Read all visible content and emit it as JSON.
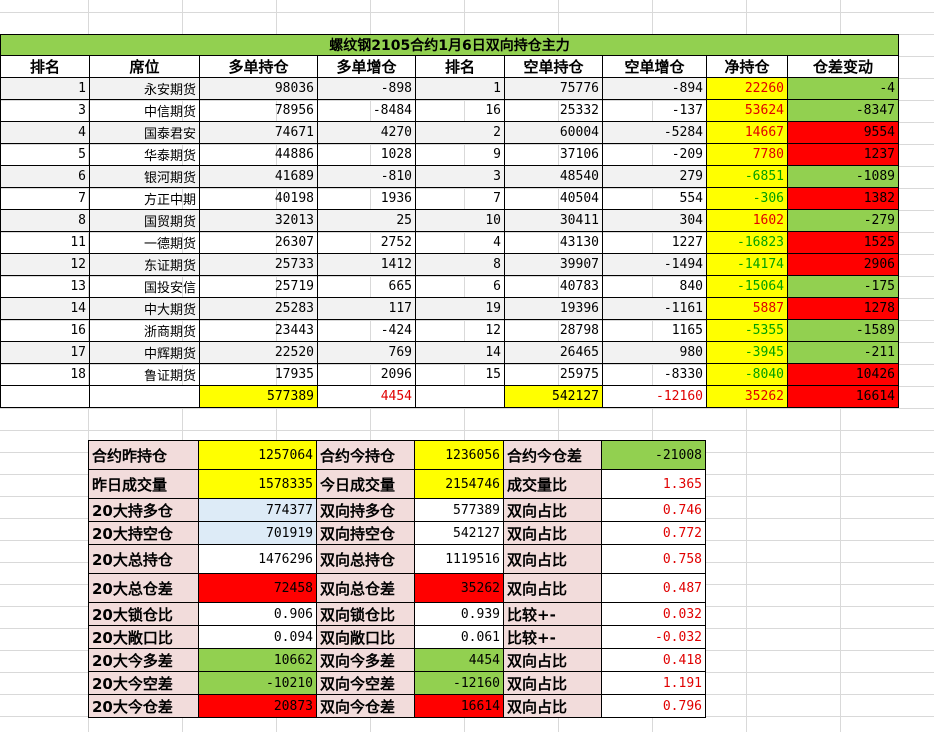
{
  "title": "螺纹钢2105合约1月6日双向持仓主力",
  "headers": [
    "排名",
    "席位",
    "多单持仓",
    "多单增仓",
    "排名",
    "空单持仓",
    "空单增仓",
    "净持仓",
    "仓差变动"
  ],
  "rows": [
    {
      "rank": "1",
      "name": "永安期货",
      "long": "98036",
      "long_chg": "-898",
      "srank": "1",
      "short": "75776",
      "short_chg": "-894",
      "net": "22260",
      "diff": "-4"
    },
    {
      "rank": "3",
      "name": "中信期货",
      "long": "78956",
      "long_chg": "-8484",
      "srank": "16",
      "short": "25332",
      "short_chg": "-137",
      "net": "53624",
      "diff": "-8347"
    },
    {
      "rank": "4",
      "name": "国泰君安",
      "long": "74671",
      "long_chg": "4270",
      "srank": "2",
      "short": "60004",
      "short_chg": "-5284",
      "net": "14667",
      "diff": "9554"
    },
    {
      "rank": "5",
      "name": "华泰期货",
      "long": "44886",
      "long_chg": "1028",
      "srank": "9",
      "short": "37106",
      "short_chg": "-209",
      "net": "7780",
      "diff": "1237"
    },
    {
      "rank": "6",
      "name": "银河期货",
      "long": "41689",
      "long_chg": "-810",
      "srank": "3",
      "short": "48540",
      "short_chg": "279",
      "net": "-6851",
      "diff": "-1089"
    },
    {
      "rank": "7",
      "name": "方正中期",
      "long": "40198",
      "long_chg": "1936",
      "srank": "7",
      "short": "40504",
      "short_chg": "554",
      "net": "-306",
      "diff": "1382"
    },
    {
      "rank": "8",
      "name": "国贸期货",
      "long": "32013",
      "long_chg": "25",
      "srank": "10",
      "short": "30411",
      "short_chg": "304",
      "net": "1602",
      "diff": "-279"
    },
    {
      "rank": "11",
      "name": "一德期货",
      "long": "26307",
      "long_chg": "2752",
      "srank": "4",
      "short": "43130",
      "short_chg": "1227",
      "net": "-16823",
      "diff": "1525"
    },
    {
      "rank": "12",
      "name": "东证期货",
      "long": "25733",
      "long_chg": "1412",
      "srank": "8",
      "short": "39907",
      "short_chg": "-1494",
      "net": "-14174",
      "diff": "2906"
    },
    {
      "rank": "13",
      "name": "国投安信",
      "long": "25719",
      "long_chg": "665",
      "srank": "6",
      "short": "40783",
      "short_chg": "840",
      "net": "-15064",
      "diff": "-175"
    },
    {
      "rank": "14",
      "name": "中大期货",
      "long": "25283",
      "long_chg": "117",
      "srank": "19",
      "short": "19396",
      "short_chg": "-1161",
      "net": "5887",
      "diff": "1278"
    },
    {
      "rank": "16",
      "name": "浙商期货",
      "long": "23443",
      "long_chg": "-424",
      "srank": "12",
      "short": "28798",
      "short_chg": "1165",
      "net": "-5355",
      "diff": "-1589"
    },
    {
      "rank": "17",
      "name": "中辉期货",
      "long": "22520",
      "long_chg": "769",
      "srank": "14",
      "short": "26465",
      "short_chg": "980",
      "net": "-3945",
      "diff": "-211"
    },
    {
      "rank": "18",
      "name": "鲁证期货",
      "long": "17935",
      "long_chg": "2096",
      "srank": "15",
      "short": "25975",
      "short_chg": "-8330",
      "net": "-8040",
      "diff": "10426"
    }
  ],
  "totals": {
    "long": "577389",
    "long_chg": "4454",
    "short": "542127",
    "short_chg": "-12160",
    "net": "35262",
    "diff": "16614"
  },
  "stats": [
    {
      "l1": "合约昨持仓",
      "v1": "1257064",
      "l2": "合约今持仓",
      "v2": "1236056",
      "l3": "合约今仓差",
      "v3": "-21008"
    },
    {
      "l1": "昨日成交量",
      "v1": "1578335",
      "l2": "今日成交量",
      "v2": "2154746",
      "l3": "成交量比",
      "v3": "1.365"
    },
    {
      "l1": "20大持多仓",
      "v1": "774377",
      "l2": "双向持多仓",
      "v2": "577389",
      "l3": "双向占比",
      "v3": "0.746"
    },
    {
      "l1": "20大持空仓",
      "v1": "701919",
      "l2": "双向持空仓",
      "v2": "542127",
      "l3": "双向占比",
      "v3": "0.772"
    },
    {
      "l1": "20大总持仓",
      "v1": "1476296",
      "l2": "双向总持仓",
      "v2": "1119516",
      "l3": "双向占比",
      "v3": "0.758"
    },
    {
      "l1": "20大总仓差",
      "v1": "72458",
      "l2": "双向总仓差",
      "v2": "35262",
      "l3": "双向占比",
      "v3": "0.487"
    },
    {
      "l1": "20大锁仓比",
      "v1": "0.906",
      "l2": "双向锁仓比",
      "v2": "0.939",
      "l3": "比较+-",
      "v3": "0.032"
    },
    {
      "l1": "20大敞口比",
      "v1": "0.094",
      "l2": "双向敞口比",
      "v2": "0.061",
      "l3": "比较+-",
      "v3": "-0.032"
    },
    {
      "l1": "20大今多差",
      "v1": "10662",
      "l2": "双向今多差",
      "v2": "4454",
      "l3": "双向占比",
      "v3": "0.418"
    },
    {
      "l1": "20大今空差",
      "v1": "-10210",
      "l2": "双向今空差",
      "v2": "-12160",
      "l3": "双向占比",
      "v3": "1.191"
    },
    {
      "l1": "20大今仓差",
      "v1": "20873",
      "l2": "双向今仓差",
      "v2": "16614",
      "l3": "双向占比",
      "v3": "0.796"
    }
  ],
  "colors": {
    "title_bg": "#92d050",
    "yellow": "#ffff00",
    "red": "#ff0000",
    "green": "#92d050",
    "pink": "#f2dcdb",
    "light_blue": "#ddebf7"
  }
}
